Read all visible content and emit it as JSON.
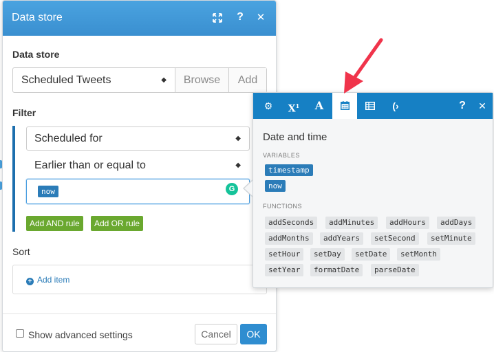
{
  "dialog": {
    "title": "Data store",
    "header_colors": {
      "bg": "#3a8fd0"
    },
    "data_store_label": "Data store",
    "data_store_value": "Scheduled Tweets",
    "browse_label": "Browse",
    "add_label": "Add",
    "filter_label": "Filter",
    "filter_field": "Scheduled for",
    "filter_operator": "Earlier than or equal to",
    "filter_value_pill": "now",
    "add_and_rule": "Add AND rule",
    "add_or_rule": "Add OR rule",
    "sort_label": "Sort",
    "add_item": "Add item",
    "advanced_label": "Show advanced settings",
    "cancel_label": "Cancel",
    "ok_label": "OK"
  },
  "popup": {
    "title": "Date and time",
    "variables_label": "VARIABLES",
    "variables": [
      "timestamp",
      "now"
    ],
    "functions_label": "FUNCTIONS",
    "functions": [
      "addSeconds",
      "addMinutes",
      "addHours",
      "addDays",
      "addMonths",
      "addYears",
      "setSecond",
      "setMinute",
      "setHour",
      "setDay",
      "setDate",
      "setMonth",
      "setYear",
      "formatDate",
      "parseDate"
    ],
    "toolbar_tabs": [
      "settings-icon",
      "superscript-icon",
      "text-icon",
      "calendar-icon",
      "table-icon",
      "general-icon"
    ],
    "active_tab": "calendar-icon",
    "toolbar_color": "#1680c4"
  },
  "annotation": {
    "arrow_color": "#f0344b"
  }
}
